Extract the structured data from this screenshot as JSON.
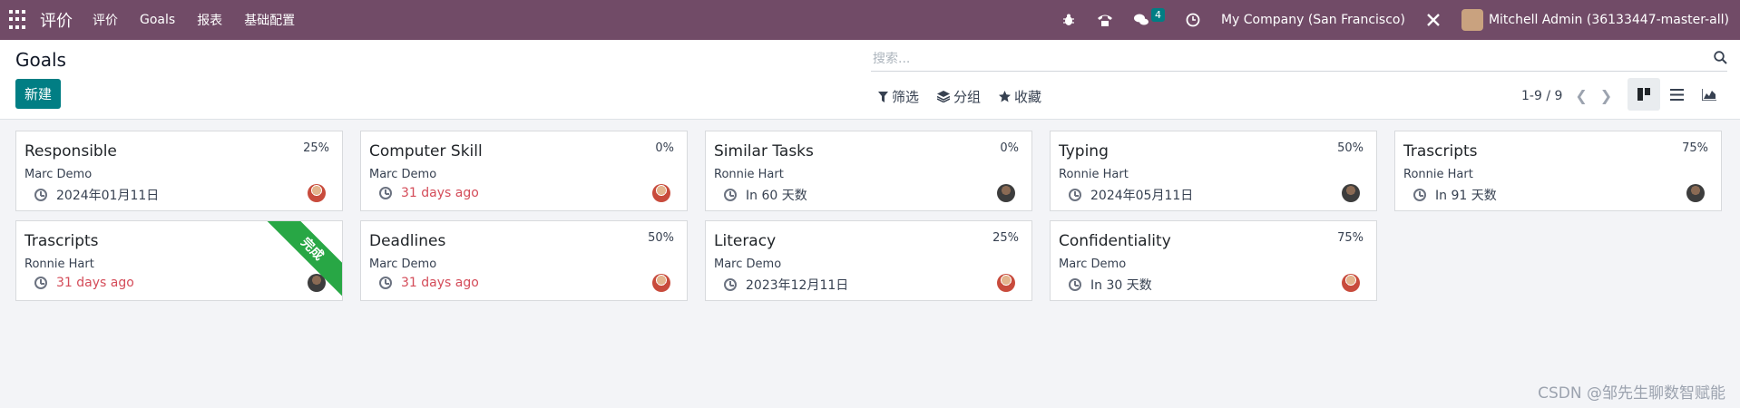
{
  "navbar": {
    "app_name": "评价",
    "menu": [
      "评价",
      "Goals",
      "报表",
      "基础配置"
    ],
    "message_count": "4",
    "company": "My Company (San Francisco)",
    "user": "Mitchell Admin (36133447-master-all)"
  },
  "control_panel": {
    "title": "Goals",
    "new_label": "新建",
    "search_placeholder": "搜索...",
    "filter_label": "筛选",
    "group_label": "分组",
    "favorites_label": "收藏",
    "pager": "1-9 / 9"
  },
  "cards": [
    {
      "title": "Responsible",
      "pct": "25%",
      "user": "Marc Demo",
      "date": "2024年01月11日",
      "overdue": false,
      "avatar": "marc"
    },
    {
      "title": "Computer Skill",
      "pct": "0%",
      "user": "Marc Demo",
      "date": "31 days ago",
      "overdue": true,
      "avatar": "marc"
    },
    {
      "title": "Similar Tasks",
      "pct": "0%",
      "user": "Ronnie Hart",
      "date": "In 60 天数",
      "overdue": false,
      "avatar": "ronnie"
    },
    {
      "title": "Typing",
      "pct": "50%",
      "user": "Ronnie Hart",
      "date": "2024年05月11日",
      "overdue": false,
      "avatar": "ronnie"
    },
    {
      "title": "Trascripts",
      "pct": "75%",
      "user": "Ronnie Hart",
      "date": "In 91 天数",
      "overdue": false,
      "avatar": "ronnie"
    },
    {
      "title": "Trascripts",
      "pct": "",
      "user": "Ronnie Hart",
      "date": "31 days ago",
      "overdue": true,
      "avatar": "ronnie",
      "ribbon": "完成"
    },
    {
      "title": "Deadlines",
      "pct": "50%",
      "user": "Marc Demo",
      "date": "31 days ago",
      "overdue": true,
      "avatar": "marc"
    },
    {
      "title": "Literacy",
      "pct": "25%",
      "user": "Marc Demo",
      "date": "2023年12月11日",
      "overdue": false,
      "avatar": "marc"
    },
    {
      "title": "Confidentiality",
      "pct": "75%",
      "user": "Marc Demo",
      "date": "In 30 天数",
      "overdue": false,
      "avatar": "marc"
    }
  ],
  "watermark": "CSDN @邹先生聊数智赋能"
}
